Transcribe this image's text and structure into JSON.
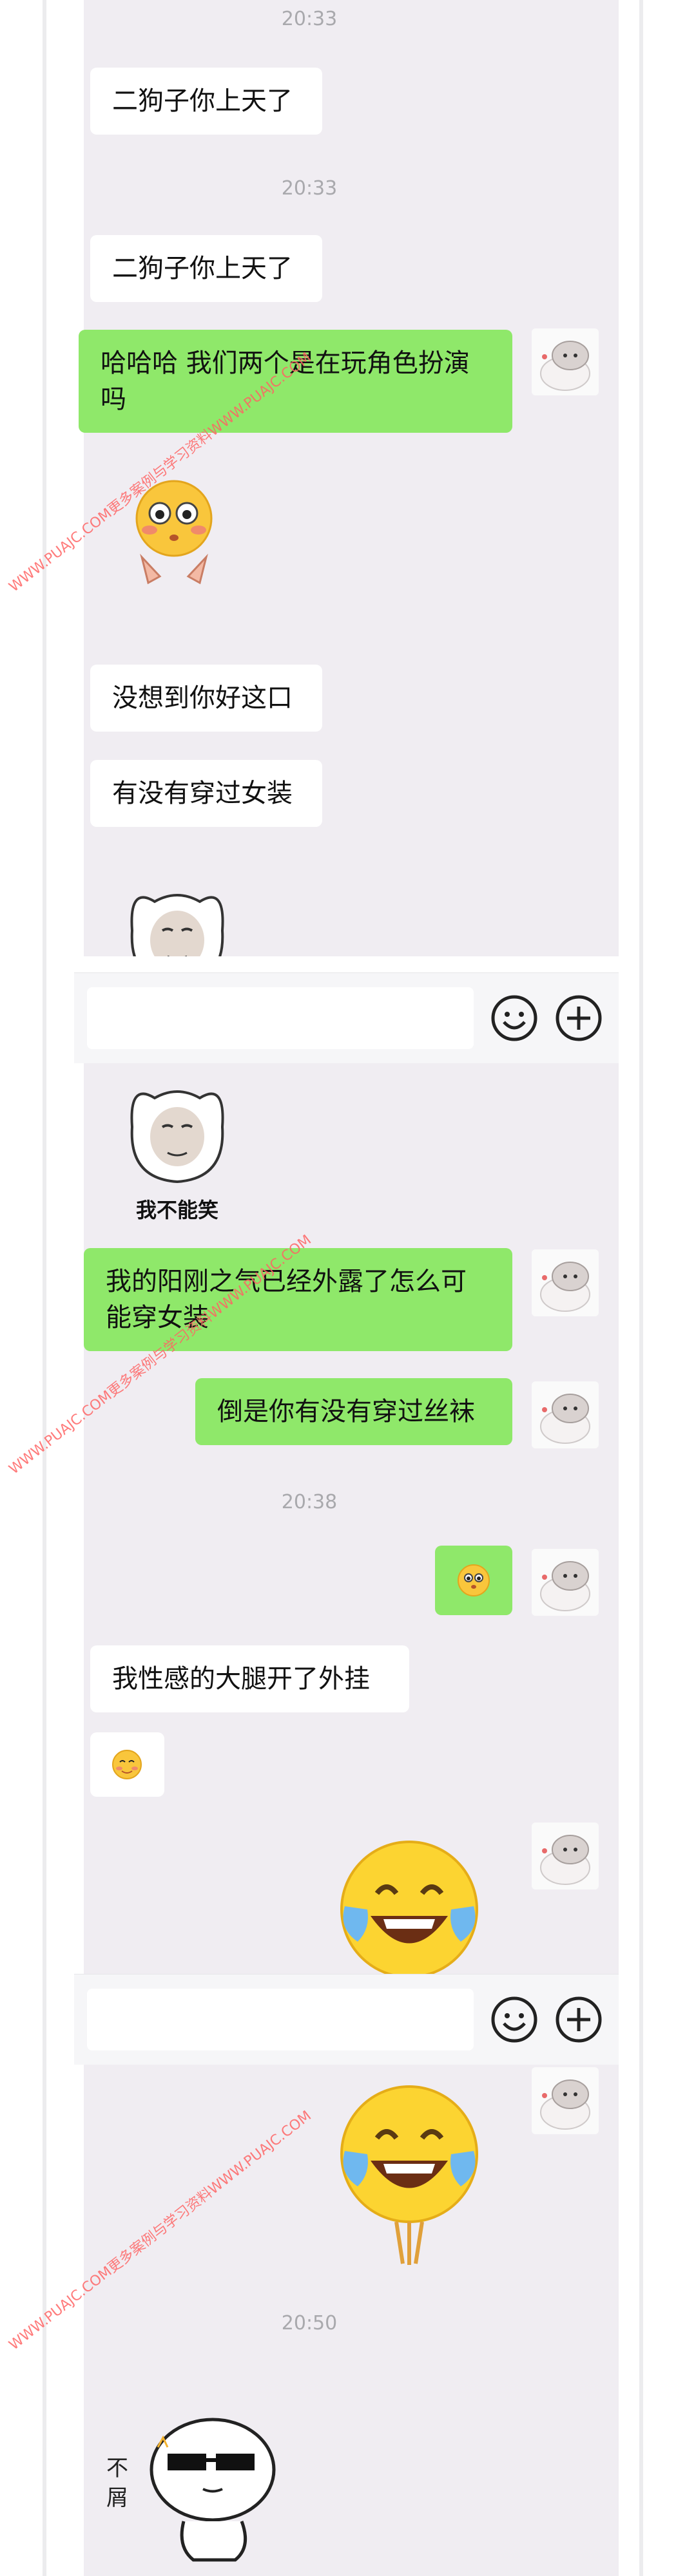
{
  "chat": {
    "timestamps": [
      "20:33",
      "20:33",
      "20:38",
      "20:50"
    ],
    "messages": [
      {
        "text": "二狗子你上天了"
      },
      {
        "text": "二狗子你上天了"
      },
      {
        "text": "哈哈哈 我们两个是在玩角色扮演吗"
      },
      {
        "text": "没想到你好这口"
      },
      {
        "text": "有没有穿过女装"
      },
      {
        "text": "我的阳刚之气已经外露了怎么可能穿女装"
      },
      {
        "text": "倒是你有没有穿过丝袜"
      },
      {
        "text": "我性感的大腿开了外挂"
      }
    ],
    "stickers": {
      "cat_face_caption": "我不能笑",
      "disdain_caption": "不屑"
    }
  },
  "watermark": {
    "text": "WWW.PUAJC.COM更多案例与学习资料WWW.PUAJC.COM"
  },
  "colors": {
    "chat_bg": "#f0edf2",
    "sent_bubble": "#8fe86a",
    "received_bubble": "#ffffff",
    "timestamp": "#a9a9ad"
  }
}
